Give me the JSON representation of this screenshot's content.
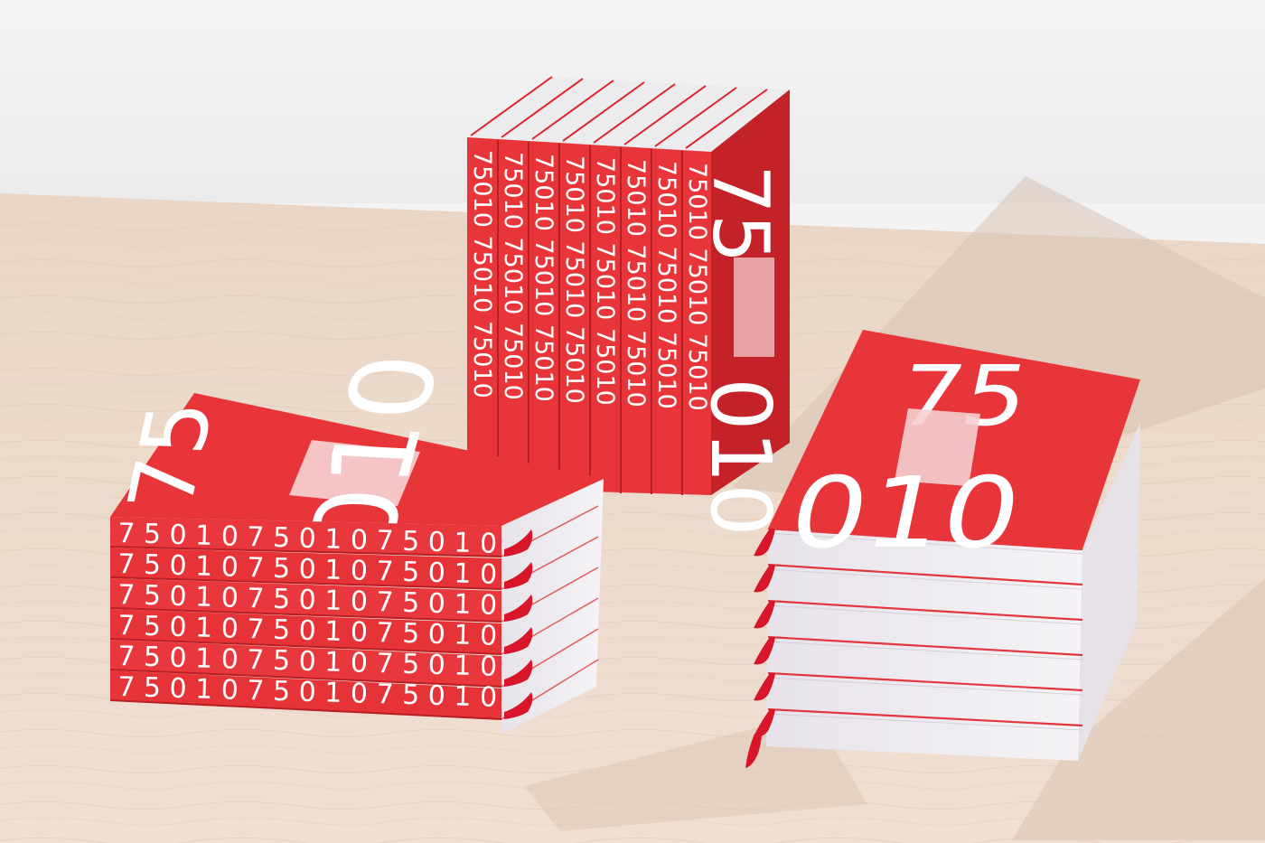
{
  "scene": {
    "description_colors": {
      "wall": "#f3f2f3",
      "table": "#ecd7c5",
      "book_red": "#e8353a",
      "book_red_dark": "#c9252b",
      "page_white": "#f1eef2",
      "ribbon": "#d8162a"
    }
  },
  "book": {
    "spine_text": "75010 75010 75010",
    "short_spine_text": "75010",
    "cover_top": "75",
    "cover_bottom": "010"
  }
}
